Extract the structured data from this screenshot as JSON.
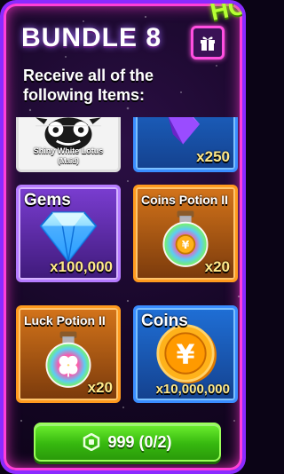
{
  "bundle": {
    "title": "BUNDLE 8",
    "subtitle": "Receive all of the following Items:",
    "badge_text": "HO"
  },
  "items": [
    {
      "name": "Shiny White Lotus",
      "variant": "(Maid)",
      "quantity": "",
      "rarity_color": "#ffffff",
      "icon": "pet-lotus-icon"
    },
    {
      "name": "",
      "quantity": "x250",
      "rarity_color": "#3a8dff",
      "icon": "purple-gem-icon"
    },
    {
      "name": "Gems",
      "quantity": "x100,000",
      "rarity_color": "#b57bff",
      "icon": "diamond-icon"
    },
    {
      "name": "Coins Potion II",
      "quantity": "x20",
      "rarity_color": "#ff9a1e",
      "icon": "coins-potion-icon"
    },
    {
      "name": "Luck Potion II",
      "quantity": "x20",
      "rarity_color": "#ff9a1e",
      "icon": "luck-potion-icon"
    },
    {
      "name": "Coins",
      "quantity": "x10,000,000",
      "rarity_color": "#3a8dff",
      "icon": "yen-coin-icon"
    }
  ],
  "purchase": {
    "price_label": "999 (0/2)",
    "currency_icon": "robux-icon"
  }
}
